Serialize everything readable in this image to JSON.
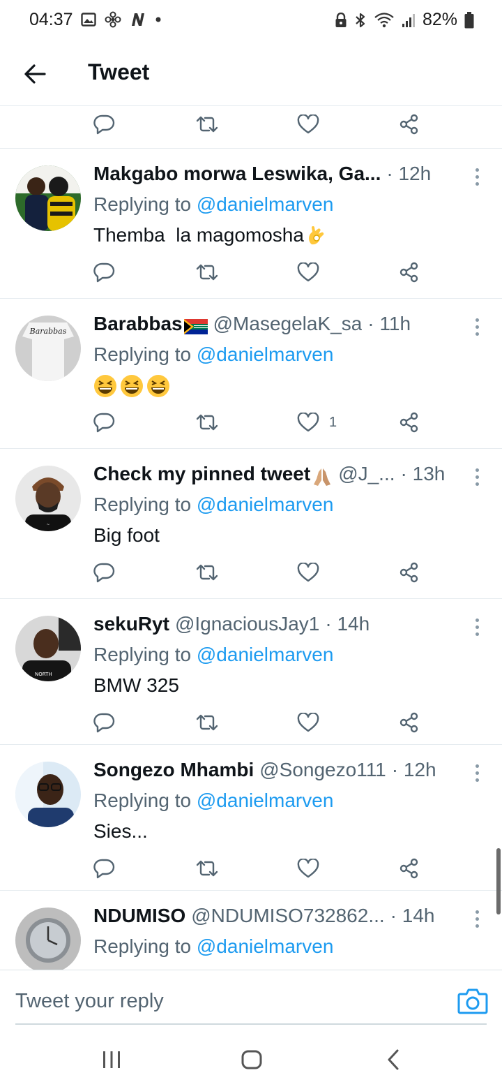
{
  "status_bar": {
    "time": "04:37",
    "battery": "82%",
    "left_icons": [
      "gallery-icon",
      "fan-icon",
      "n-icon",
      "dot-icon"
    ],
    "right_icons": [
      "lock-icon",
      "bluetooth-icon",
      "wifi-icon",
      "signal-icon",
      "battery-icon"
    ]
  },
  "header": {
    "title": "Tweet"
  },
  "prev_actions": {
    "like_count": ""
  },
  "tweets": [
    {
      "name": "Makgabo morwa Leswika, Ga...",
      "handle": "",
      "time": "· 12h",
      "reply_prefix": "Replying to ",
      "reply_to": "@danielmarven",
      "text": "Themba  la magomosha",
      "emoji": "ok-hand-emoji",
      "like_count": ""
    },
    {
      "name": "Barabbas",
      "handle": "@MasegelaK_sa",
      "time": "· 11h",
      "reply_prefix": "Replying to ",
      "reply_to": "@danielmarven",
      "text": "",
      "emoji": "laughing-emoji x3",
      "avatar_text": "Barabbas",
      "like_count": "1"
    },
    {
      "name": "Check my pinned tweet",
      "handle": "@J_...",
      "time": "· 13h",
      "reply_prefix": "Replying to ",
      "reply_to": "@danielmarven",
      "text": "Big foot",
      "emoji": "praying-hands-emoji",
      "like_count": ""
    },
    {
      "name": "sekuRyt",
      "handle": "@IgnaciousJay1",
      "time": "· 14h",
      "reply_prefix": "Replying to ",
      "reply_to": "@danielmarven",
      "text": "BMW 325",
      "like_count": ""
    },
    {
      "name": "Songezo Mhambi",
      "handle": "@Songezo111",
      "time": "· 12h",
      "reply_prefix": "Replying to ",
      "reply_to": "@danielmarven",
      "text": "Sies...",
      "like_count": ""
    },
    {
      "name": "NDUMISO",
      "handle": "@NDUMISO732862...",
      "time": "· 14h",
      "reply_prefix": "Replying to ",
      "reply_to": "@danielmarven",
      "text": ""
    }
  ],
  "composer": {
    "placeholder": "Tweet your reply"
  },
  "colors": {
    "accent": "#1d9bf0",
    "text_primary": "#0f1419",
    "text_secondary": "#536471",
    "divider": "#e6ecf0"
  }
}
